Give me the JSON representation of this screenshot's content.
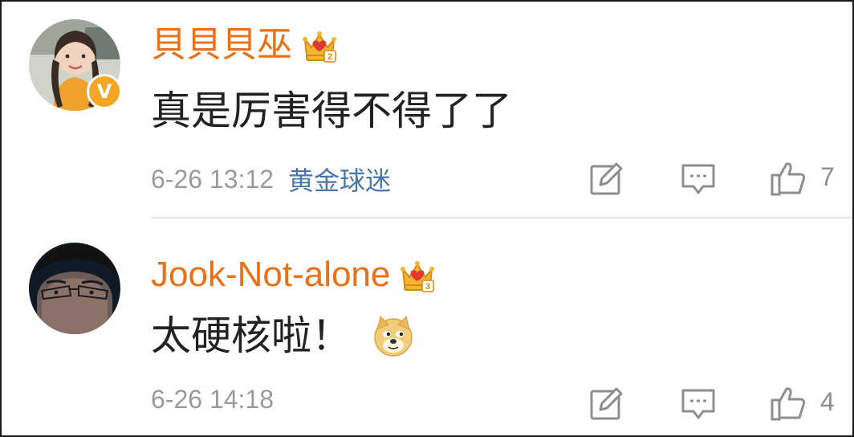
{
  "comments": [
    {
      "username": "貝貝貝巫",
      "text": "真是厉害得不得了了",
      "time": "6-26 13:12",
      "source": "黄金球迷",
      "likes": "7",
      "verified_badge": "V",
      "crown_level": "2",
      "avatar_icon": "avatar-girl-photo",
      "has_emoji": false
    },
    {
      "username": "Jook-Not-alone",
      "text": "太硬核啦！",
      "time": "6-26 14:18",
      "source": "",
      "likes": "4",
      "crown_level": "3",
      "avatar_icon": "avatar-man-glasses-photo",
      "emoji_icon": "doge-emoji",
      "has_emoji": true
    }
  ],
  "colors": {
    "username": "#eb7016",
    "source": "#4a76a8",
    "meta": "#9a9a9a",
    "verified": "#f5a623"
  }
}
